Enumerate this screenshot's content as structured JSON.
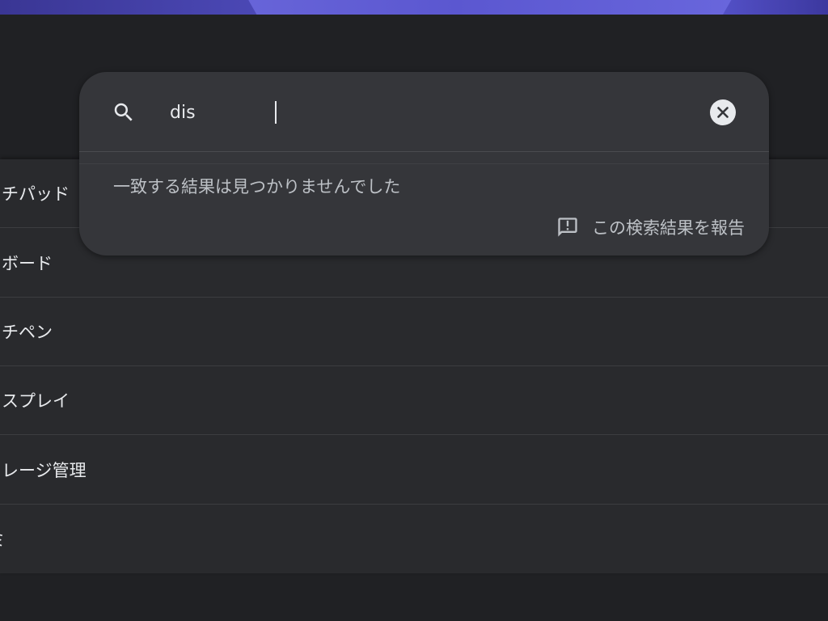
{
  "search": {
    "value": "dis",
    "no_results_text": "一致する結果は見つかりませんでした",
    "report_label": "この検索結果を報告"
  },
  "list": {
    "items": [
      {
        "label": "チパッド"
      },
      {
        "label": "ボード"
      },
      {
        "label": "チペン"
      },
      {
        "label": "スプレイ"
      },
      {
        "label": "レージ管理"
      },
      {
        "label": "ミ"
      }
    ]
  },
  "icons": {
    "search": "search-icon",
    "clear": "clear-icon",
    "feedback": "feedback-icon"
  },
  "colors": {
    "background": "#202124",
    "surface": "#292a2d",
    "search_surface": "#35363a",
    "text_primary": "#e8eaed",
    "text_secondary": "#bdc1c6"
  }
}
